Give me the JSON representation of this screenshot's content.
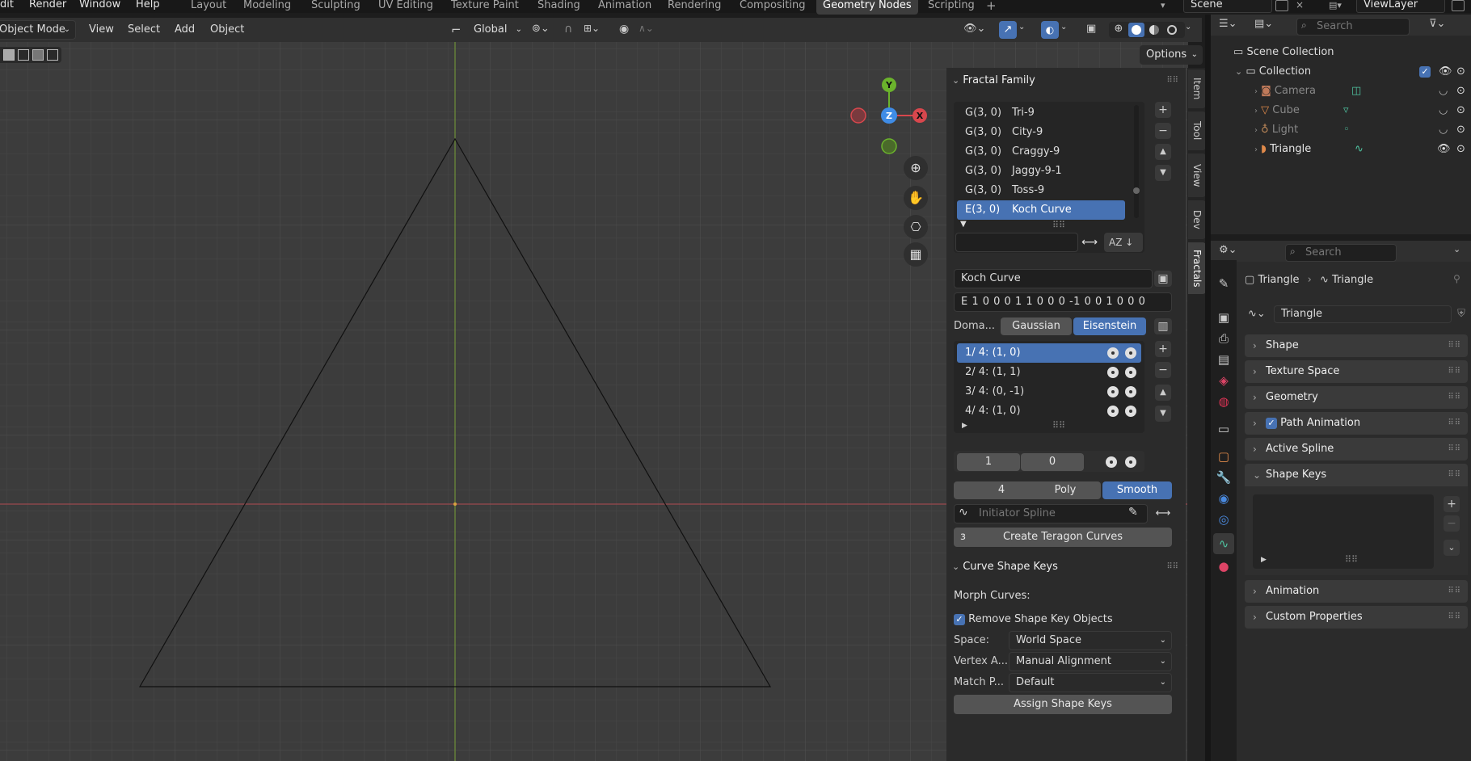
{
  "menubar": {
    "items": [
      "dit",
      "Render",
      "Window",
      "Help"
    ]
  },
  "workspaces": {
    "tabs": [
      "Layout",
      "Modeling",
      "Sculpting",
      "UV Editing",
      "Texture Paint",
      "Shading",
      "Animation",
      "Rendering",
      "Compositing",
      "Geometry Nodes",
      "Scripting"
    ],
    "active": "Geometry Nodes"
  },
  "scene": {
    "name": "Scene",
    "view_layer": "ViewLayer"
  },
  "viewport_header": {
    "mode": "Object Mode",
    "menus": [
      "View",
      "Select",
      "Add",
      "Object"
    ],
    "transform_orientation": "Global",
    "options": "Options"
  },
  "npanel_tabs": [
    "Item",
    "Tool",
    "View",
    "Dev",
    "Fractals"
  ],
  "fractal_family": {
    "title": "Fractal Family",
    "items": [
      {
        "domain": "G(3, 0)",
        "name": "Tri-9"
      },
      {
        "domain": "G(3, 0)",
        "name": "City-9"
      },
      {
        "domain": "G(3, 0)",
        "name": "Craggy-9"
      },
      {
        "domain": "G(3, 0)",
        "name": "Jaggy-9-1"
      },
      {
        "domain": "G(3, 0)",
        "name": "Toss-9"
      },
      {
        "domain": "E(3, 0)",
        "name": "Koch Curve"
      }
    ],
    "selected_index": 5,
    "filter_value": "",
    "sort_label": "AZ",
    "current_name": "Koch Curve",
    "code": "E 1 0 0 0 1 1 0 0 0 -1 0 0 1 0 0 0",
    "domain_label": "Doma...",
    "domain_options": [
      "Gaussian",
      "Eisenstein"
    ],
    "domain_selected": "Eisenstein",
    "generators": [
      "1/ 4: (1, 0)",
      "2/ 4: (1, 1)",
      "3/ 4: (0, -1)",
      "4/ 4: (1, 0)"
    ],
    "generator_selected": 0,
    "vec_a": "1",
    "vec_b": "0",
    "level": "4",
    "curve_modes": [
      "Poly",
      "Smooth"
    ],
    "curve_mode_selected": "Smooth",
    "initiator_placeholder": "Initiator Spline",
    "create_button": "Create Teragon Curves"
  },
  "curve_shape_keys": {
    "title": "Curve Shape Keys",
    "morph_label": "Morph Curves:",
    "remove_label": "Remove Shape Key Objects",
    "remove_checked": true,
    "space_label": "Space:",
    "space_value": "World Space",
    "vertex_label": "Vertex A...",
    "vertex_value": "Manual Alignment",
    "match_label": "Match P...",
    "match_value": "Default",
    "assign_button": "Assign Shape Keys"
  },
  "gizmo": {
    "y": "Y",
    "x": "X",
    "z": "Z"
  },
  "outliner": {
    "search_placeholder": "Search",
    "scene_collection": "Scene Collection",
    "collection": "Collection",
    "objects": [
      {
        "name": "Camera",
        "color": "#c07a5a"
      },
      {
        "name": "Cube",
        "color": "#e08a4a"
      },
      {
        "name": "Light",
        "color": "#c08a5a"
      },
      {
        "name": "Triangle",
        "color": "#4fc3a0"
      }
    ]
  },
  "properties": {
    "search_placeholder": "Search",
    "breadcrumb": [
      "Triangle",
      "Triangle"
    ],
    "data_name": "Triangle",
    "sections": [
      "Shape",
      "Texture Space",
      "Geometry",
      "Path Animation",
      "Active Spline",
      "Shape Keys",
      "Animation",
      "Custom Properties"
    ],
    "path_animation_checked": true
  },
  "colors": {
    "accent": "#4772b3",
    "x_axis": "#d8474d",
    "y_axis": "#6bb32c",
    "z_axis": "#3f8ce6"
  }
}
